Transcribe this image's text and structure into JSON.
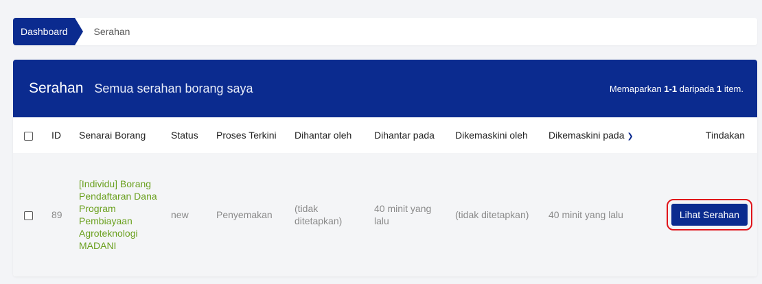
{
  "breadcrumb": {
    "home": "Dashboard",
    "current": "Serahan"
  },
  "header": {
    "title": "Serahan",
    "subtitle": "Semua serahan borang saya",
    "summary_prefix": "Memaparkan ",
    "summary_range": "1-1",
    "summary_mid": " daripada ",
    "summary_total": "1",
    "summary_suffix": " item."
  },
  "table": {
    "columns": {
      "id": "ID",
      "form": "Senarai Borang",
      "status": "Status",
      "process": "Proses Terkini",
      "sent_by": "Dihantar oleh",
      "sent_at": "Dihantar pada",
      "updated_by": "Dikemaskini oleh",
      "updated_at": "Dikemaskini pada",
      "actions": "Tindakan"
    },
    "rows": [
      {
        "id": "89",
        "form": "[Individu] Borang Pendaftaran Dana Program Pembiayaan Agroteknologi MADANI",
        "status": "new",
        "process": "Penyemakan",
        "sent_by": "(tidak ditetapkan)",
        "sent_at": "40 minit yang lalu",
        "updated_by": "(tidak ditetapkan)",
        "updated_at": "40 minit yang lalu",
        "action_label": "Lihat Serahan"
      }
    ]
  },
  "icons": {
    "sort": "chevron-down-icon"
  },
  "colors": {
    "primary": "#0b2b8f",
    "link": "#6aa01e",
    "highlight": "#e0141a"
  }
}
